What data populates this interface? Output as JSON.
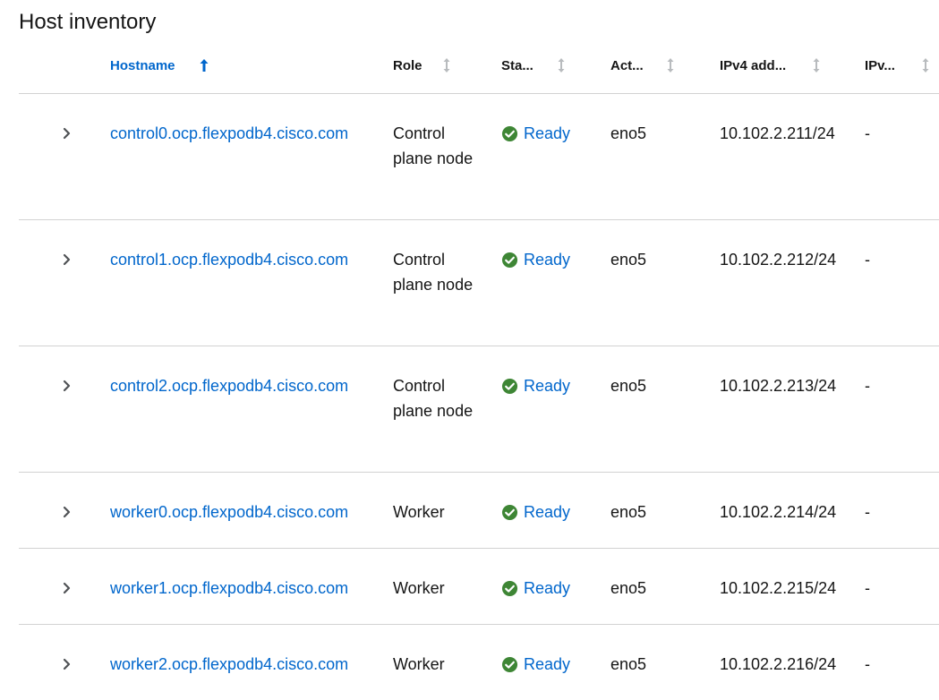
{
  "page": {
    "title": "Host inventory"
  },
  "table": {
    "columns": {
      "hostname": "Hostname",
      "role": "Role",
      "status": "Sta...",
      "active_nic": "Act...",
      "ipv4": "IPv4 add...",
      "ipv6": "IPv..."
    },
    "sorted_column": "Hostname",
    "sort_direction": "ascending",
    "rows": [
      {
        "hostname": "control0.ocp.flexpodb4.cisco.com",
        "role": "Control plane node",
        "status": "Ready",
        "active_nic": "eno5",
        "ipv4": "10.102.2.211/24",
        "ipv6": "-"
      },
      {
        "hostname": "control1.ocp.flexpodb4.cisco.com",
        "role": "Control plane node",
        "status": "Ready",
        "active_nic": "eno5",
        "ipv4": "10.102.2.212/24",
        "ipv6": "-"
      },
      {
        "hostname": "control2.ocp.flexpodb4.cisco.com",
        "role": "Control plane node",
        "status": "Ready",
        "active_nic": "eno5",
        "ipv4": "10.102.2.213/24",
        "ipv6": "-"
      },
      {
        "hostname": "worker0.ocp.flexpodb4.cisco.com",
        "role": "Worker",
        "status": "Ready",
        "active_nic": "eno5",
        "ipv4": "10.102.2.214/24",
        "ipv6": "-"
      },
      {
        "hostname": "worker1.ocp.flexpodb4.cisco.com",
        "role": "Worker",
        "status": "Ready",
        "active_nic": "eno5",
        "ipv4": "10.102.2.215/24",
        "ipv6": "-"
      },
      {
        "hostname": "worker2.ocp.flexpodb4.cisco.com",
        "role": "Worker",
        "status": "Ready",
        "active_nic": "eno5",
        "ipv4": "10.102.2.216/24",
        "ipv6": "-"
      }
    ]
  },
  "colors": {
    "link": "#0066cc",
    "success": "#3e8635",
    "border": "#d2d2d2",
    "sort_inactive": "#b8bbbe"
  },
  "icons": {
    "expand": "chevron-right-icon",
    "status_ok": "check-circle-icon",
    "sort_active": "arrow-up-icon",
    "sort_inactive": "sort-updown-icon"
  }
}
